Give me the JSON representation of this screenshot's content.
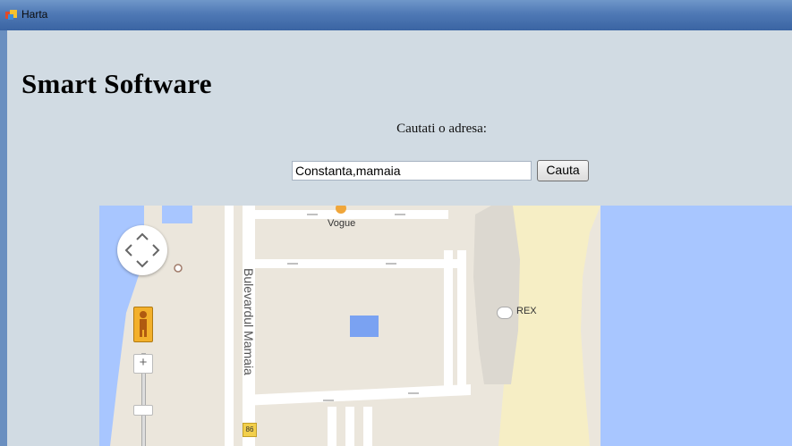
{
  "window": {
    "title": "Harta"
  },
  "header": {
    "title": "Smart Software",
    "prompt": "Cautati o adresa:"
  },
  "search": {
    "value": "Constanta,mamaia",
    "button_label": "Cauta"
  },
  "map": {
    "labels": {
      "vogue": "Vogue",
      "rex": "REX",
      "street": "Bulevardul Mamaia",
      "road_number": "86"
    },
    "colors": {
      "land": "#ebe6dc",
      "water": "#a8c6ff",
      "beach": "#f6eec5",
      "road": "#ffffff"
    }
  }
}
